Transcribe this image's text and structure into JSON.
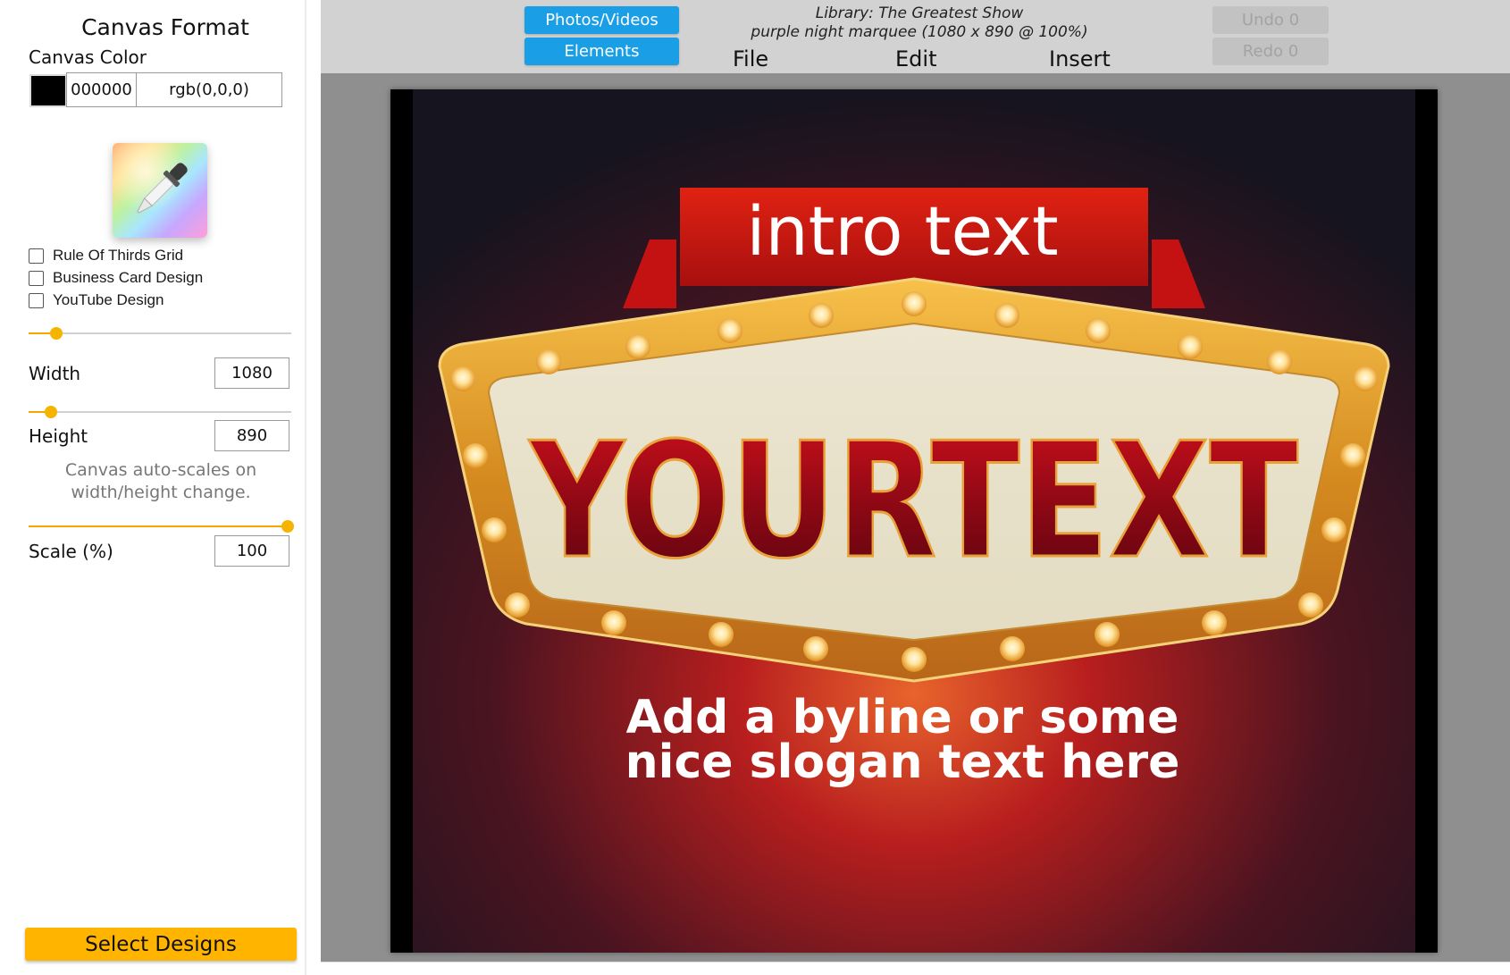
{
  "sidebar": {
    "title": "Canvas Format",
    "canvas_color_label": "Canvas Color",
    "color_hex": "000000",
    "color_rgb": "rgb(0,0,0)",
    "swatch_color": "#000000",
    "picker_icon": "eyedropper-icon",
    "checkboxes": [
      {
        "label": "Rule Of Thirds Grid",
        "checked": false
      },
      {
        "label": "Business Card Design",
        "checked": false
      },
      {
        "label": "YouTube Design",
        "checked": false
      }
    ],
    "width_label": "Width",
    "width_value": "1080",
    "height_label": "Height",
    "height_value": "890",
    "note": "Canvas auto-scales on width/height change.",
    "scale_label": "Scale (%)",
    "scale_value": "100",
    "select_designs": "Select Designs",
    "accent_color": "#ffb400"
  },
  "topbar": {
    "photos_videos": "Photos/Videos",
    "elements": "Elements",
    "library_line1": "Library: The Greatest Show",
    "library_line2": "purple night marquee (1080 x 890 @ 100%)",
    "menu": [
      "File",
      "Edit",
      "Insert"
    ],
    "undo": "Undo 0",
    "redo": "Redo 0",
    "button_color": "#1a9ee6"
  },
  "design": {
    "intro_text": "intro text",
    "main_text": "YOURTEXT",
    "byline_line1": "Add a byline or some",
    "byline_line2": "nice slogan text here"
  }
}
